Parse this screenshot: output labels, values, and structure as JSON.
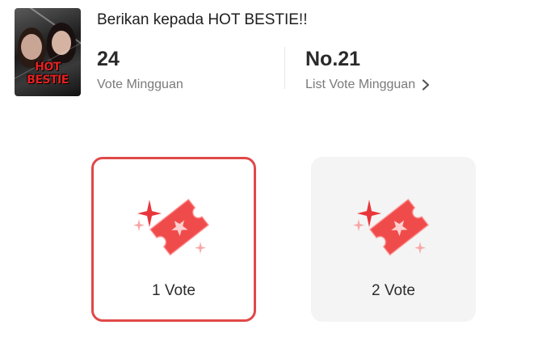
{
  "header": {
    "title": "Berikan kepada HOT BESTIE!!",
    "cover_text": "HOT BESTIE"
  },
  "stats": {
    "votes_value": "24",
    "votes_label": "Vote Mingguan",
    "rank_value": "No.21",
    "rank_label": "List Vote Mingguan"
  },
  "options": [
    {
      "label": "1 Vote",
      "selected": true
    },
    {
      "label": "2 Vote",
      "selected": false
    }
  ],
  "icons": {
    "ticket": "ticket-icon",
    "sparkle": "sparkle-icon",
    "chevron": "chevron-right-icon"
  },
  "colors": {
    "accent": "#e04848",
    "ticket": "#f04b4b"
  }
}
